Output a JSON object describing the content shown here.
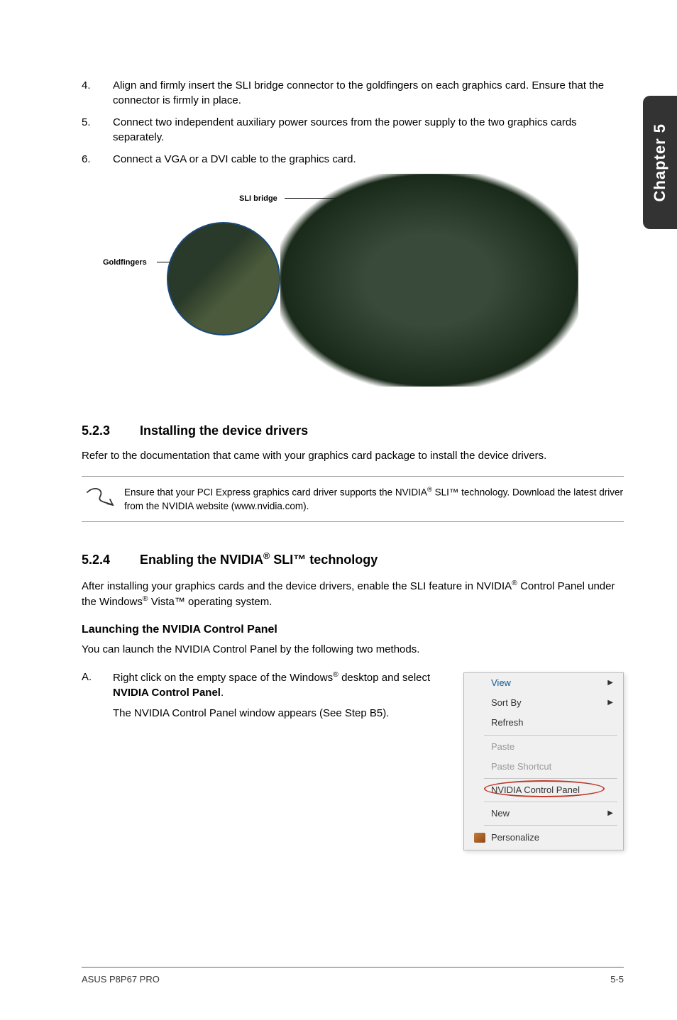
{
  "sideTab": "Chapter 5",
  "steps": {
    "s4": {
      "num": "4.",
      "text": "Align and firmly insert the SLI bridge connector to the goldfingers on each graphics card. Ensure that the connector is firmly in place."
    },
    "s5": {
      "num": "5.",
      "text": "Connect two independent auxiliary power sources from the power supply to the two graphics cards separately."
    },
    "s6": {
      "num": "6.",
      "text": "Connect a VGA or a DVI cable to the graphics card."
    }
  },
  "diagram": {
    "sliBridge": "SLI bridge",
    "goldfingers": "Goldfingers"
  },
  "sec523": {
    "num": "5.2.3",
    "title": "Installing the device drivers",
    "para": "Refer to the documentation that came with your graphics card package to install the device drivers.",
    "noteA": "Ensure that your PCI Express graphics card driver supports the NVIDIA",
    "noteB": " SLI™ technology. Download the latest driver from the NVIDIA website (www.nvidia.com)."
  },
  "sec524": {
    "num": "5.2.4",
    "titleA": "Enabling the NVIDIA",
    "titleB": " SLI™ technology",
    "paraA": "After installing your graphics cards and the device drivers, enable the SLI feature in NVIDIA",
    "paraB": " Control Panel under the Windows",
    "paraC": " Vista™ operating system.",
    "subheading": "Launching the NVIDIA Control Panel",
    "subpara": "You can launch the NVIDIA Control Panel by the following two methods.",
    "itemA": {
      "num": "A.",
      "line1a": "Right click on the empty space of the Windows",
      "line1b": " desktop and select ",
      "line1bold": "NVIDIA Control Panel",
      "line1c": ".",
      "line2": "The NVIDIA Control Panel window appears (See Step B5)."
    }
  },
  "menu": {
    "view": "View",
    "sortBy": "Sort By",
    "refresh": "Refresh",
    "paste": "Paste",
    "pasteShortcut": "Paste Shortcut",
    "nvidia": "NVIDIA Control Panel",
    "new": "New",
    "personalize": "Personalize"
  },
  "footer": {
    "left": "ASUS P8P67 PRO",
    "right": "5-5"
  }
}
